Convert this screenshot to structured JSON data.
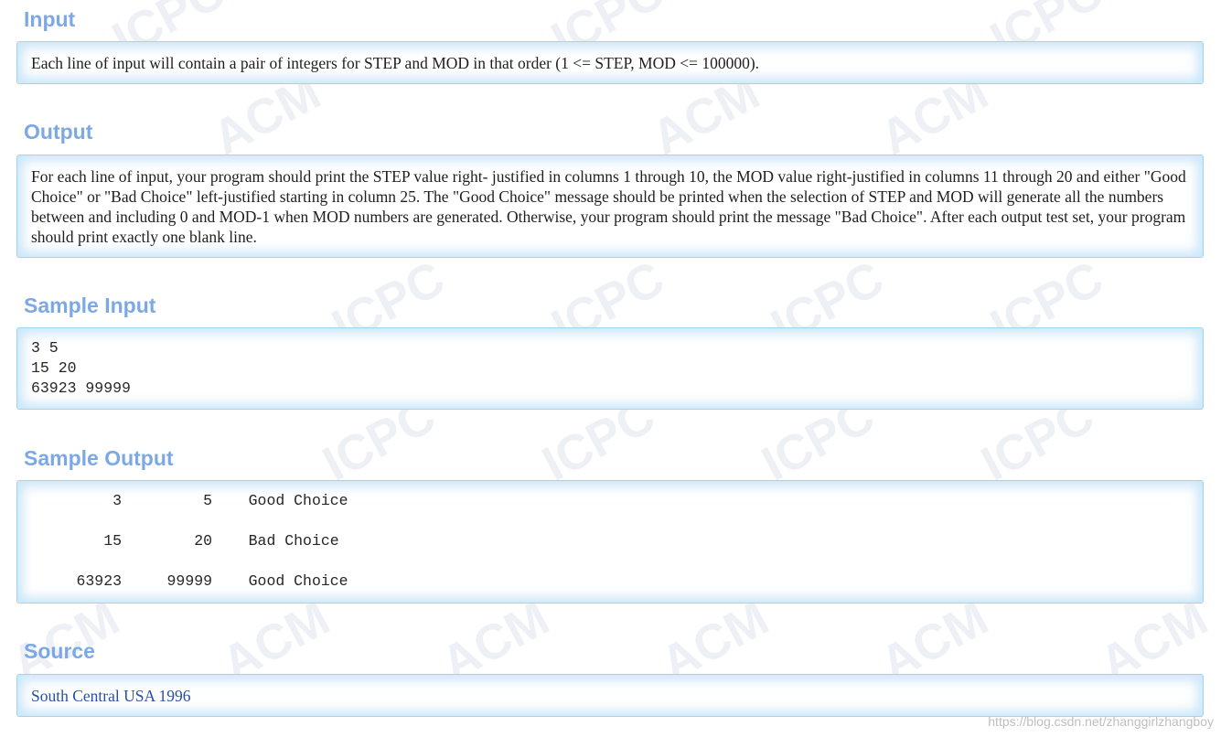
{
  "watermark": {
    "row_top": "ICPC",
    "row_mid": "ACM"
  },
  "sections": {
    "input": {
      "heading": "Input",
      "text": "Each line of input will contain a pair of integers for STEP and MOD in that order (1 <= STEP, MOD <= 100000)."
    },
    "output": {
      "heading": "Output",
      "text": "For each line of input, your program should print the STEP value right- justified in columns 1 through 10, the MOD value right-justified in columns 11 through 20 and either \"Good Choice\" or \"Bad Choice\" left-justified starting in column 25. The \"Good Choice\" message should be printed when the selection of STEP and MOD will generate all the numbers between and including 0 and MOD-1 when MOD numbers are generated. Otherwise, your program should print the message \"Bad Choice\". After each output test set, your program should print exactly one blank line."
    },
    "sample_input": {
      "heading": "Sample Input",
      "lines": [
        "3 5",
        "15 20",
        "63923 99999"
      ]
    },
    "sample_output": {
      "heading": "Sample Output",
      "lines": [
        "         3         5    Good Choice",
        "        15        20    Bad Choice",
        "     63923     99999    Good Choice"
      ]
    },
    "source": {
      "heading": "Source",
      "link_text": "South Central USA 1996"
    }
  },
  "credit": "https://blog.csdn.net/zhanggirlzhangboy"
}
